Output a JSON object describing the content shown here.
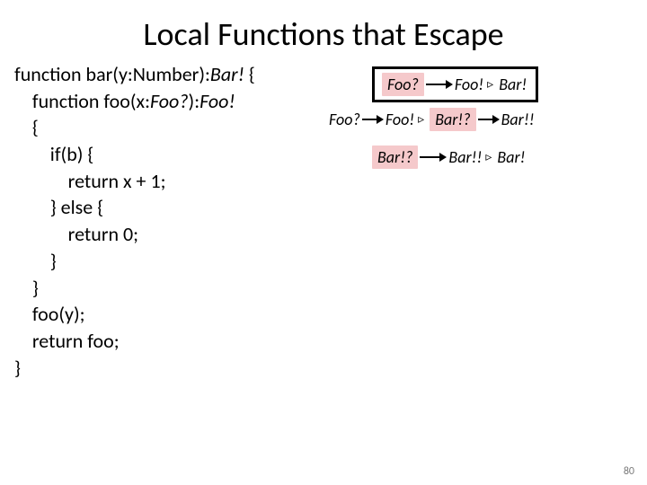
{
  "title": "Local Functions that Escape",
  "code": {
    "l1a": "function bar(y:Number):",
    "l1b": "Bar!",
    "l1c": " {",
    "l2a": "    function foo(x:",
    "l2b": "Foo?",
    "l2c": "):",
    "l2d": "Foo!",
    "l3": "    {",
    "l4": "        if(b) {",
    "l5": "            return x + 1;",
    "l6": "        } else {",
    "l7": "            return 0;",
    "l8": "        }",
    "l9": "    }",
    "l10": "    foo(y);",
    "l11": "    return foo;",
    "l12": "}"
  },
  "rules": {
    "r1": {
      "lhs": "Foo?",
      "mid": "Foo!",
      "rhs": "Bar!"
    },
    "r2": {
      "lhs": "Foo?",
      "mid": "Foo!",
      "rhs1": "Bar!?",
      "final": "Bar!!"
    },
    "r3": {
      "lhs": "Bar!?",
      "mid": "Bar!!",
      "rhs": "Bar!"
    }
  },
  "triangle": "▹",
  "pagenum": "80"
}
